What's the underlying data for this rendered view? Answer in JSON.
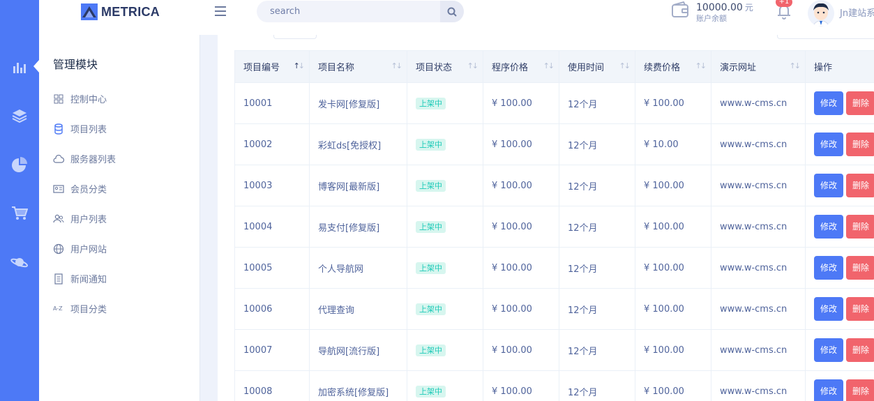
{
  "brand": {
    "name": "METRICA"
  },
  "search": {
    "placeholder": "search"
  },
  "account": {
    "balance": "10000.00",
    "unit": "元",
    "label": "账户余额"
  },
  "notifications": {
    "badge": "+1"
  },
  "user": {
    "name": "Jn建站系"
  },
  "rail": {
    "items": [
      "bar-chart-icon",
      "layers-icon",
      "pie-chart-icon",
      "cart-icon",
      "planet-icon"
    ]
  },
  "submenu": {
    "title": "管理模块",
    "items": [
      {
        "label": "控制中心",
        "icon": "grid-icon"
      },
      {
        "label": "项目列表",
        "icon": "database-icon"
      },
      {
        "label": "服务器列表",
        "icon": "cloud-icon"
      },
      {
        "label": "会员分类",
        "icon": "id-card-icon"
      },
      {
        "label": "用户列表",
        "icon": "users-icon"
      },
      {
        "label": "用户网站",
        "icon": "globe-icon"
      },
      {
        "label": "新闻通知",
        "icon": "document-icon"
      },
      {
        "label": "项目分类",
        "icon": "a-z-icon"
      }
    ]
  },
  "table": {
    "headers": [
      "项目编号",
      "项目名称",
      "项目状态",
      "程序价格",
      "使用时间",
      "续费价格",
      "演示网址",
      "操作"
    ],
    "actions": {
      "edit": "修改",
      "delete": "删除"
    },
    "rows": [
      {
        "id": "10001",
        "name": "发卡网[修复版]",
        "status": "上架中",
        "price": "¥ 100.00",
        "duration": "12个月",
        "renew": "¥ 100.00",
        "url": "www.w-cms.cn"
      },
      {
        "id": "10002",
        "name": "彩虹ds[免授权]",
        "status": "上架中",
        "price": "¥ 100.00",
        "duration": "12个月",
        "renew": "¥ 10.00",
        "url": "www.w-cms.cn"
      },
      {
        "id": "10003",
        "name": "博客网[最新版]",
        "status": "上架中",
        "price": "¥ 100.00",
        "duration": "12个月",
        "renew": "¥ 100.00",
        "url": "www.w-cms.cn"
      },
      {
        "id": "10004",
        "name": "易支付[修复版]",
        "status": "上架中",
        "price": "¥ 100.00",
        "duration": "12个月",
        "renew": "¥ 100.00",
        "url": "www.w-cms.cn"
      },
      {
        "id": "10005",
        "name": "个人导航网",
        "status": "上架中",
        "price": "¥ 100.00",
        "duration": "12个月",
        "renew": "¥ 100.00",
        "url": "www.w-cms.cn"
      },
      {
        "id": "10006",
        "name": "代理查询",
        "status": "上架中",
        "price": "¥ 100.00",
        "duration": "12个月",
        "renew": "¥ 100.00",
        "url": "www.w-cms.cn"
      },
      {
        "id": "10007",
        "name": "导航网[流行版]",
        "status": "上架中",
        "price": "¥ 100.00",
        "duration": "12个月",
        "renew": "¥ 100.00",
        "url": "www.w-cms.cn"
      },
      {
        "id": "10008",
        "name": "加密系统[修复版]",
        "status": "上架中",
        "price": "¥ 100.00",
        "duration": "12个月",
        "renew": "¥ 100.00",
        "url": "www.w-cms.cn"
      }
    ]
  },
  "colors": {
    "primary": "#4d79f6",
    "danger": "#f1646c",
    "success": "#1ecab8"
  }
}
